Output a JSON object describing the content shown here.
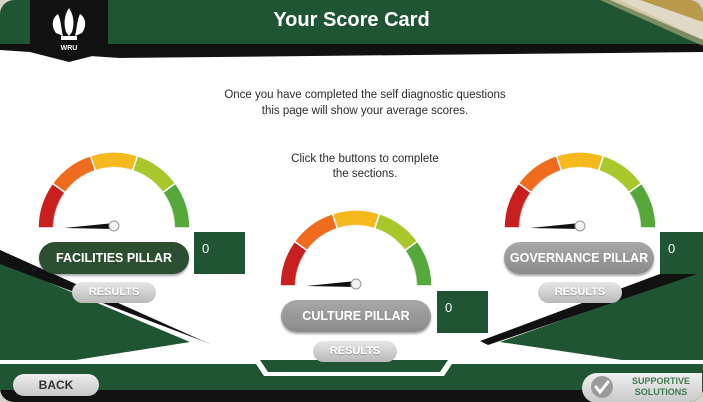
{
  "header": {
    "title": "Your Score Card",
    "logo_text": "WRU"
  },
  "intro": {
    "line1": "Once you have completed the self diagnostic questions",
    "line2": "this page will show your average scores."
  },
  "instruction": {
    "line1": "Click the buttons to complete",
    "line2": "the sections."
  },
  "pillars": [
    {
      "label": "FACILITIES PILLAR",
      "score": "0",
      "results_label": "RESULTS",
      "level": 0
    },
    {
      "label": "CULTURE PILLAR",
      "score": "0",
      "results_label": "RESULTS",
      "level": 0
    },
    {
      "label": "GOVERNANCE PILLAR",
      "score": "0",
      "results_label": "RESULTS",
      "level": 0
    }
  ],
  "footer": {
    "back_label": "BACK",
    "support_line1": "SUPPORTIVE",
    "support_line2": "SOLUTIONS"
  },
  "colors": {
    "brand_green": "#1f5533",
    "header_black": "#111111",
    "gold": "#b89a4a",
    "gauge": [
      "#c9201f",
      "#ef6c1f",
      "#f5b81d",
      "#a8c72a",
      "#57a83a"
    ]
  },
  "icons": {
    "logo": "prince-of-wales-feathers-icon",
    "check": "check-icon",
    "needle": "gauge-needle-icon"
  }
}
